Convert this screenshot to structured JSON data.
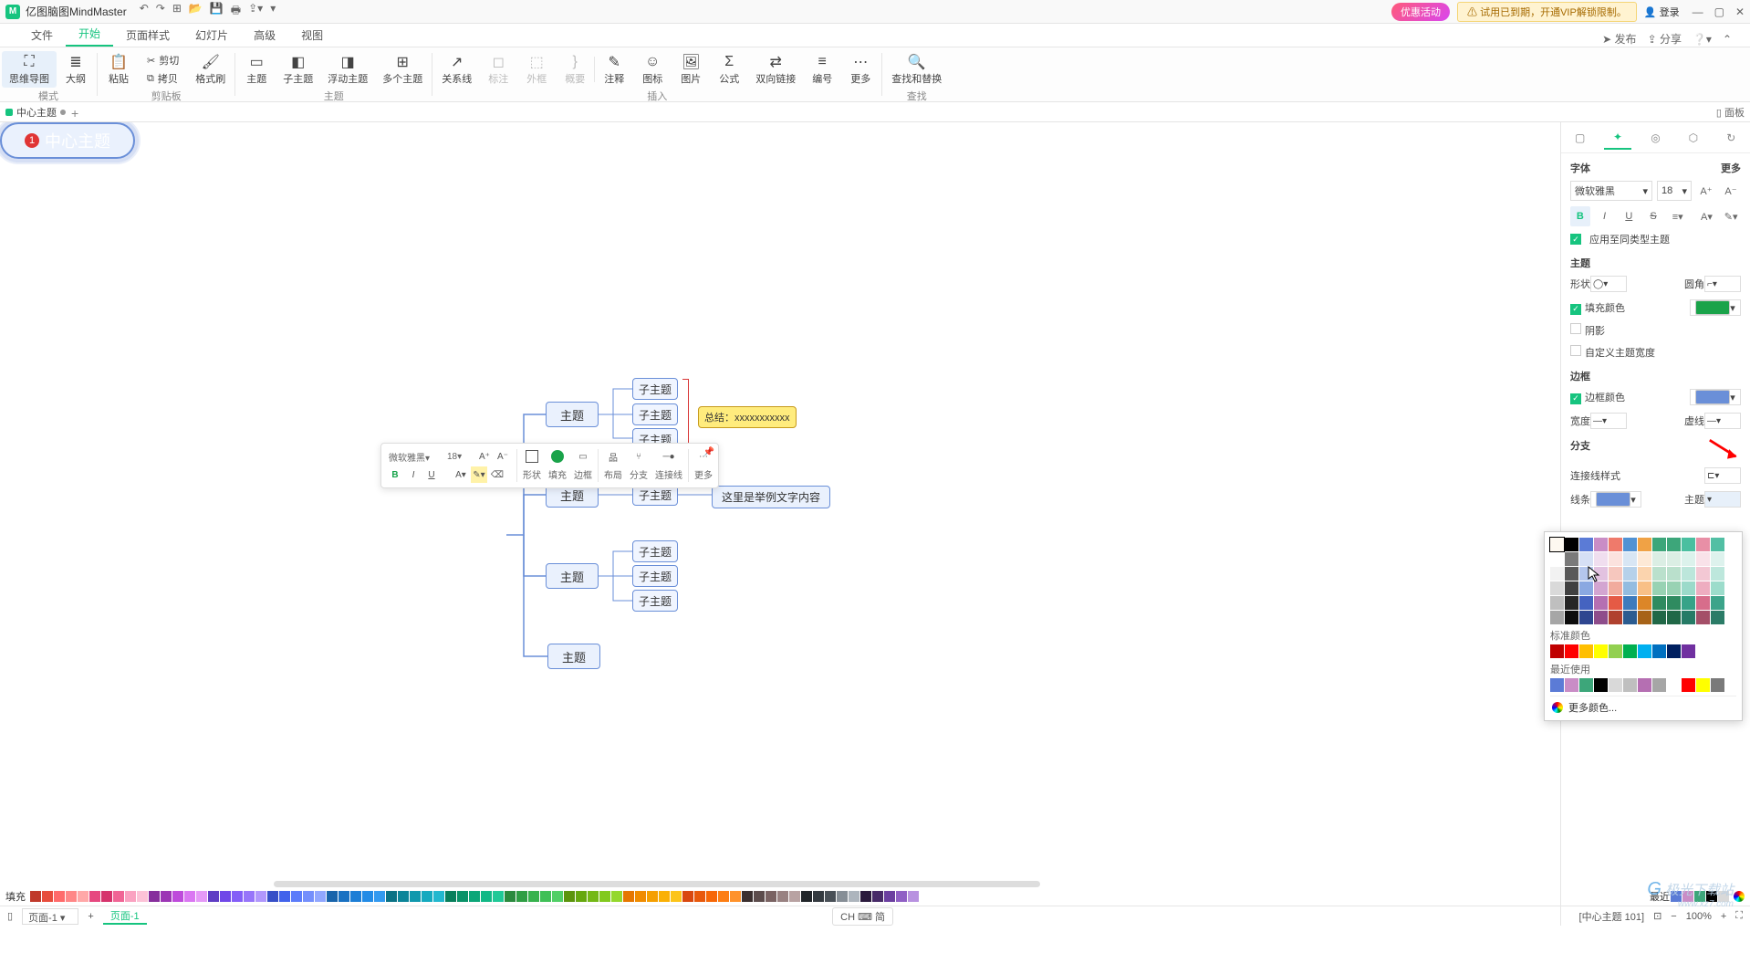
{
  "app": {
    "title": "亿图脑图MindMaster"
  },
  "titlebar": {
    "promo": "优惠活动",
    "trial": "⚠ 试用已到期，开通VIP解锁限制。",
    "login": "登录"
  },
  "menu": {
    "items": [
      "文件",
      "开始",
      "页面样式",
      "幻灯片",
      "高级",
      "视图"
    ],
    "active": 1,
    "right": {
      "publish": "发布",
      "share": "分享"
    }
  },
  "ribbon": {
    "groups": [
      {
        "label": "模式",
        "btns": [
          {
            "id": "mindmap",
            "icon": "⛶",
            "text": "思维导图",
            "active": true
          },
          {
            "id": "outline",
            "icon": "≣",
            "text": "大纲"
          }
        ]
      },
      {
        "label": "剪贴板",
        "stack": [
          {
            "id": "paste",
            "icon": "📋",
            "text": "粘贴",
            "big": true
          },
          {
            "id": "cut",
            "icon": "✂",
            "text": "剪切"
          },
          {
            "id": "copy",
            "icon": "⧉",
            "text": "拷贝"
          },
          {
            "id": "format",
            "icon": "🖌",
            "text": "格式刷",
            "big": true
          }
        ]
      },
      {
        "label": "主题",
        "btns": [
          {
            "id": "topic",
            "icon": "▭",
            "text": "主题"
          },
          {
            "id": "subtopic",
            "icon": "◧",
            "text": "子主题"
          },
          {
            "id": "float",
            "icon": "◨",
            "text": "浮动主题"
          },
          {
            "id": "multi",
            "icon": "⊞",
            "text": "多个主题"
          }
        ]
      },
      {
        "label": "插入",
        "btns": [
          {
            "id": "relation",
            "icon": "↗",
            "text": "关系线"
          },
          {
            "id": "callout",
            "icon": "◻",
            "text": "标注",
            "disabled": true
          },
          {
            "id": "boundary",
            "icon": "⬚",
            "text": "外框",
            "disabled": true
          },
          {
            "id": "summary",
            "icon": "}",
            "text": "概要",
            "disabled": true
          },
          {
            "id": "note",
            "icon": "✎",
            "text": "注释"
          },
          {
            "id": "iconlib",
            "icon": "☺",
            "text": "图标"
          },
          {
            "id": "image",
            "icon": "🖼",
            "text": "图片"
          },
          {
            "id": "formula",
            "icon": "Σ",
            "text": "公式"
          },
          {
            "id": "hyperlink",
            "icon": "⇄",
            "text": "双向链接"
          },
          {
            "id": "number",
            "icon": "≡",
            "text": "编号"
          },
          {
            "id": "more",
            "icon": "⋯",
            "text": "更多"
          }
        ]
      },
      {
        "label": "查找",
        "btns": [
          {
            "id": "find",
            "icon": "🔍",
            "text": "查找和替换"
          }
        ]
      }
    ]
  },
  "tabs": {
    "name": "中心主题"
  },
  "canvas": {
    "centre": {
      "text": "中心主题",
      "badge": "1"
    },
    "topics": [
      "主题",
      "主题",
      "主题",
      "主题"
    ],
    "subs": [
      "子主题",
      "子主题",
      "子主题",
      "子主题",
      "子主题",
      "子主题",
      "子主题"
    ],
    "summary": "总结：xxxxxxxxxxx",
    "example": "这里是举例文字内容"
  },
  "floatbar": {
    "font": "微软雅黑",
    "size": "18",
    "labels": {
      "shape": "形状",
      "fill": "填充",
      "border": "边框",
      "layout": "布局",
      "branch": "分支",
      "connect": "连接线",
      "more": "更多"
    }
  },
  "sidepanel": {
    "font_section": {
      "title": "字体",
      "more": "更多",
      "font": "微软雅黑",
      "size": "18",
      "apply_same": "应用至同类型主题"
    },
    "topic_section": {
      "title": "主题",
      "shape": "形状",
      "corner": "圆角",
      "fill": "填充颜色",
      "shadow": "阴影",
      "custom_width": "自定义主题宽度"
    },
    "border_section": {
      "title": "边框",
      "color": "边框颜色",
      "width": "宽度",
      "dash": "虚线"
    },
    "branch_section": {
      "title": "分支",
      "connector": "连接线样式",
      "line": "线条",
      "topic": "主题"
    }
  },
  "colorpop": {
    "theme_rows": [
      [
        "#fdf8f0",
        "#000000",
        "#5b7bd6",
        "#c98dc6",
        "#ef7a6b",
        "#5192d4",
        "#f0a245",
        "#3da67a",
        "#3da67a",
        "#4abfa0",
        "#e88fa6",
        "#52bfa4"
      ],
      [
        "#ffffff",
        "#7a7a7a",
        "#d6e0f5",
        "#f0deef",
        "#fbe2de",
        "#d8e6f4",
        "#fde9d6",
        "#dbeee4",
        "#dbeee4",
        "#dcf2ec",
        "#f9e2e9",
        "#ddf2ed"
      ],
      [
        "#f2f2f2",
        "#595959",
        "#b4c6ec",
        "#e2c2e0",
        "#f6c7be",
        "#b6d1ea",
        "#fbd4ae",
        "#bae0cc",
        "#bae0cc",
        "#bce6db",
        "#f3c8d4",
        "#bde7dc"
      ],
      [
        "#d9d9d9",
        "#404040",
        "#8aa8e1",
        "#d3a5d1",
        "#f1ab9d",
        "#93bce0",
        "#f8c087",
        "#98d2b3",
        "#98d2b3",
        "#9bdaca",
        "#eeadc0",
        "#9cdccb"
      ],
      [
        "#bfbfbf",
        "#262626",
        "#4563c0",
        "#b56fb2",
        "#e55a45",
        "#3d7bbd",
        "#dc8628",
        "#2f8b60",
        "#2f8b60",
        "#36a388",
        "#d76d8b",
        "#3ca48a"
      ],
      [
        "#a6a6a6",
        "#0d0d0d",
        "#2f4690",
        "#8e4d8b",
        "#b0412f",
        "#2c5c90",
        "#a76318",
        "#216847",
        "#216847",
        "#267b66",
        "#a44f68",
        "#2b7c67"
      ]
    ],
    "standard_label": "标准颜色",
    "standard": [
      "#c00000",
      "#ff0000",
      "#ffbf00",
      "#ffff00",
      "#92d050",
      "#00b050",
      "#00b0f0",
      "#0070c0",
      "#002060",
      "#7030a0"
    ],
    "recent_label": "最近使用",
    "recent": [
      "#5b7bd6",
      "#c98dc6",
      "#3da67a",
      "#000000",
      "#d9d9d9",
      "#bfbfbf",
      "#b56fb2",
      "#a6a6a6",
      "#ffffff",
      "#ff0000",
      "#ffff00",
      "#7a7a7a"
    ],
    "more": "更多颜色..."
  },
  "palette": {
    "label": "填充",
    "colors": [
      "#c0392b",
      "#e74c3c",
      "#ff6b6b",
      "#ff8787",
      "#ffa8a8",
      "#e64980",
      "#d6336c",
      "#f06595",
      "#faa2c1",
      "#fcc2d7",
      "#862e9c",
      "#9c36b5",
      "#be4bdb",
      "#da77f2",
      "#e599f7",
      "#5f3dc4",
      "#7048e8",
      "#845ef7",
      "#9775fa",
      "#b197fc",
      "#364fc7",
      "#4263eb",
      "#5c7cfa",
      "#748ffc",
      "#91a7ff",
      "#1864ab",
      "#1971c2",
      "#1c7ed6",
      "#228be6",
      "#339af0",
      "#0b7285",
      "#0c8599",
      "#1098ad",
      "#15aabf",
      "#22b8cf",
      "#087f5b",
      "#099268",
      "#0ca678",
      "#12b886",
      "#20c997",
      "#2b8a3e",
      "#2f9e44",
      "#37b24d",
      "#40c057",
      "#51cf66",
      "#5c940d",
      "#66a80f",
      "#74b816",
      "#82c91e",
      "#94d82d",
      "#e67700",
      "#f08c00",
      "#f59f00",
      "#fab005",
      "#fcc419",
      "#d9480f",
      "#e8590c",
      "#f76707",
      "#fd7e14",
      "#ff922b",
      "#3b2f2f",
      "#5c4c4c",
      "#7a6363",
      "#998282",
      "#b8a2a2",
      "#212529",
      "#343a40",
      "#495057",
      "#868e96",
      "#adb5bd",
      "#2b1a3d",
      "#472a68",
      "#6b3fa0",
      "#9060c5",
      "#b892e0"
    ],
    "recent": "最近",
    "recent_colors": [
      "#5b7bd6",
      "#c98dc6",
      "#3da67a",
      "#000000",
      "#d9d9d9"
    ]
  },
  "status": {
    "page_sel": "页面-1",
    "page_tab": "页面-1",
    "ime": "CH ⌨ 简",
    "coord": "[中心主题 101]",
    "fit": "⊡",
    "zoom": "100%"
  },
  "watermark": "极光下载站"
}
